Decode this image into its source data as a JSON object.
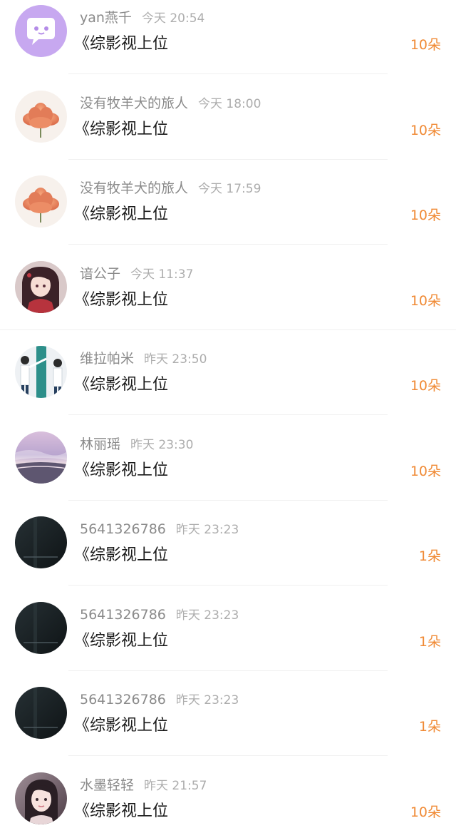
{
  "gifts": [
    {
      "user": "yan燕千",
      "time": "今天 20:54",
      "book": "《综影视上位",
      "count": "10朵",
      "avatar_icon": "purple-chat-avatar-icon"
    },
    {
      "user": "没有牧羊犬的旅人",
      "time": "今天 18:00",
      "book": "《综影视上位",
      "count": "10朵",
      "avatar_icon": "flower-avatar-icon"
    },
    {
      "user": "没有牧羊犬的旅人",
      "time": "今天 17:59",
      "book": "《综影视上位",
      "count": "10朵",
      "avatar_icon": "flower-avatar-icon"
    },
    {
      "user": "谙公子",
      "time": "今天 11:37",
      "book": "《综影视上位",
      "count": "10朵",
      "avatar_icon": "illustrated-woman-avatar-icon"
    },
    {
      "user": "维拉帕米",
      "time": "昨天 23:50",
      "book": "《综影视上位",
      "count": "10朵",
      "avatar_icon": "dancers-avatar-icon"
    },
    {
      "user": "林丽瑶",
      "time": "昨天 23:30",
      "book": "《综影视上位",
      "count": "10朵",
      "avatar_icon": "sky-landscape-avatar-icon"
    },
    {
      "user": "5641326786",
      "time": "昨天 23:23",
      "book": "《综影视上位",
      "count": "1朵",
      "avatar_icon": "dark-avatar-icon"
    },
    {
      "user": "5641326786",
      "time": "昨天 23:23",
      "book": "《综影视上位",
      "count": "1朵",
      "avatar_icon": "dark-avatar-icon"
    },
    {
      "user": "5641326786",
      "time": "昨天 23:23",
      "book": "《综影视上位",
      "count": "1朵",
      "avatar_icon": "dark-avatar-icon"
    },
    {
      "user": "水墨轻轻",
      "time": "昨天 21:57",
      "book": "《综影视上位",
      "count": "10朵",
      "avatar_icon": "girl-portrait-avatar-icon"
    }
  ],
  "colors": {
    "accent": "#f08a35",
    "username": "#8a8a8a",
    "time": "#adadad",
    "title": "#1b1b1b"
  }
}
